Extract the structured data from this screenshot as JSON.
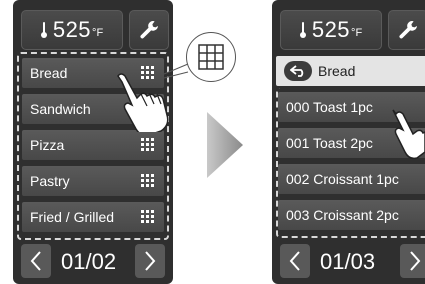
{
  "left": {
    "temp_value": "525",
    "temp_unit": "°F",
    "menu": [
      "Bread",
      "Sandwich",
      "Pizza",
      "Pastry",
      "Fried / Grilled"
    ],
    "page_indicator": "01/02"
  },
  "right": {
    "temp_value": "525",
    "temp_unit": "°F",
    "back_label": "Bread",
    "items": [
      "000 Toast 1pc",
      "001 Toast 2pc",
      "002 Croissant 1pc",
      "003 Croissant 2pc"
    ],
    "page_indicator": "01/03"
  },
  "pager": {
    "prev_glyph": "<",
    "next_glyph": ">"
  },
  "icons": {
    "temperature": "thermometer-icon",
    "settings": "wrench-icon",
    "category_grid": "grid-icon",
    "back": "back-arrow-icon",
    "transition": "play-arrow-icon",
    "hand": "pointing-hand-icon"
  },
  "colors": {
    "panel_bg": "#2f2f2f",
    "row_bg": "#525252",
    "back_row_bg": "#e4e4e4",
    "dashed_border": "#d8d8d8"
  }
}
